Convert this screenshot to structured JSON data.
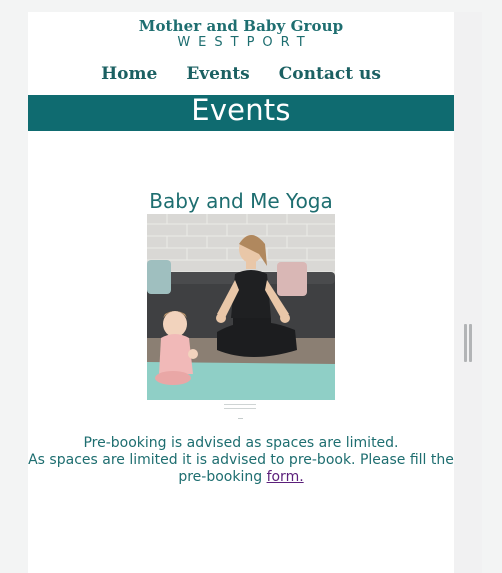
{
  "brand": {
    "name": "Mother and Baby Group",
    "place": "WESTPORT"
  },
  "nav": {
    "home": "Home",
    "events": "Events",
    "contact": "Contact us"
  },
  "banner": {
    "title": "Events"
  },
  "event": {
    "title": "Baby and Me Yoga",
    "image_alt": "Woman doing yoga with baby on mat",
    "line1": "Pre-booking is advised as spaces are limited.",
    "line2": "As spaces are limited it is advised to pre-book. Please fill the pre-booking",
    "link": "form."
  },
  "colors": {
    "accent": "#0f6b70",
    "text": "#1e6e70",
    "link": "#5b1f7a"
  }
}
